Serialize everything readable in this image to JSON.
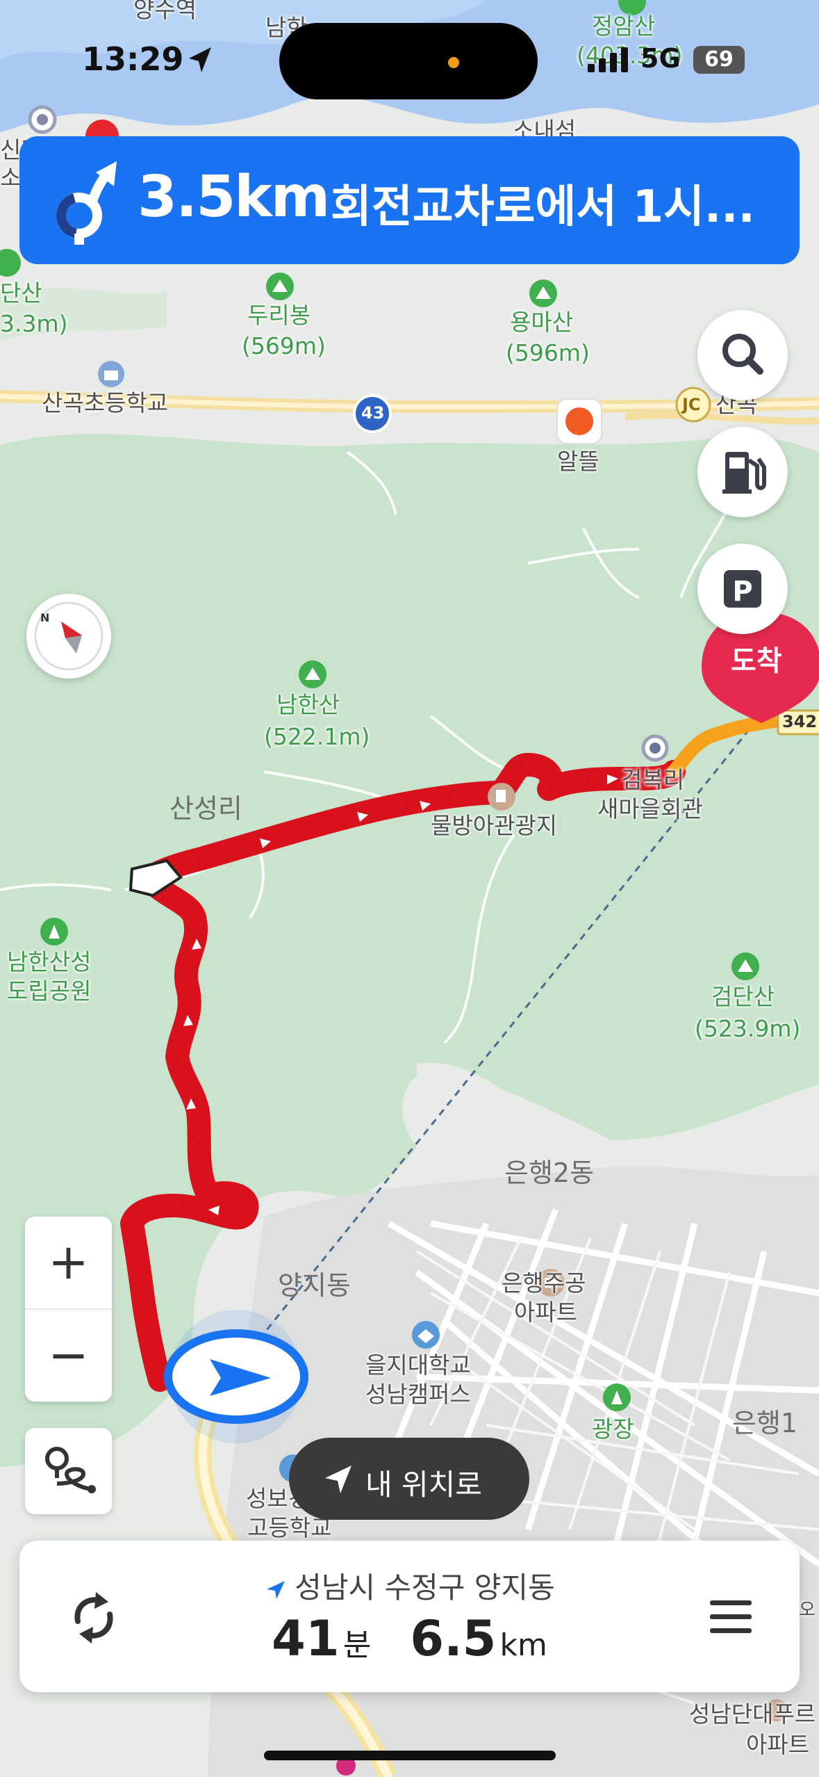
{
  "status_bar": {
    "time": "13:29",
    "network": "5G",
    "battery": "69"
  },
  "banner": {
    "distance": "3.5km",
    "instruction": "회전교차로에서 1시...",
    "color": "#1a73f0"
  },
  "map": {
    "labels": {
      "yangsu_station": "양수역",
      "namhan": "남한",
      "jeongamsan": "정암산",
      "jeongamsan_elev": "(403.3m)",
      "sinaeseon": "소내섬",
      "singdang": "신당",
      "so": "소",
      "dansan": "단산",
      "dansan_elev": "3.3m)",
      "duribong": "두리봉",
      "duribong_elev": "(569m)",
      "yongmasan": "용마산",
      "yongmasan_elev": "(596m)",
      "sangok_school": "산곡초등학교",
      "route_43": "43",
      "jc": "JC",
      "sangok": "산곡",
      "altteul": "알뜰",
      "namhansan": "남한산",
      "namhansan_elev": "(522.1m)",
      "sanseongri": "산성리",
      "mulbanga": "물방아관광지",
      "geombokri_line1": "검복리",
      "geombokri_line2": "새마을회관",
      "route_342": "342",
      "namhansanseong_line1": "남한산성",
      "namhansanseong_line2": "도립공원",
      "geomdansan": "검단산",
      "geomdansan_elev": "(523.9m)",
      "eunhaeng2": "은행2동",
      "yangji": "양지동",
      "eunhaeng_apt_line1": "은행주공",
      "eunhaeng_apt_line2": "아파트",
      "eulji_line1": "을지대학교",
      "eulji_line2": "성남캠퍼스",
      "gwangjang": "광장",
      "eunhaeng1": "은행1",
      "seongbo_line1": "성보경영",
      "seongbo_line2": "고등학교",
      "seongnam_dafu_line1": "성남단대푸르",
      "seongnam_dafu_line2": "아파트",
      "o": "오",
      "arrival": "도착"
    },
    "route_color": "#d8111c",
    "final_segment_color": "#f5a11b"
  },
  "controls": {
    "zoom_in": "+",
    "zoom_out": "−",
    "my_location": "내 위치로"
  },
  "summary": {
    "destination": "성남시 수정구 양지동",
    "minutes": "41",
    "minutes_unit": "분",
    "distance": "6.5",
    "distance_unit": "km"
  }
}
